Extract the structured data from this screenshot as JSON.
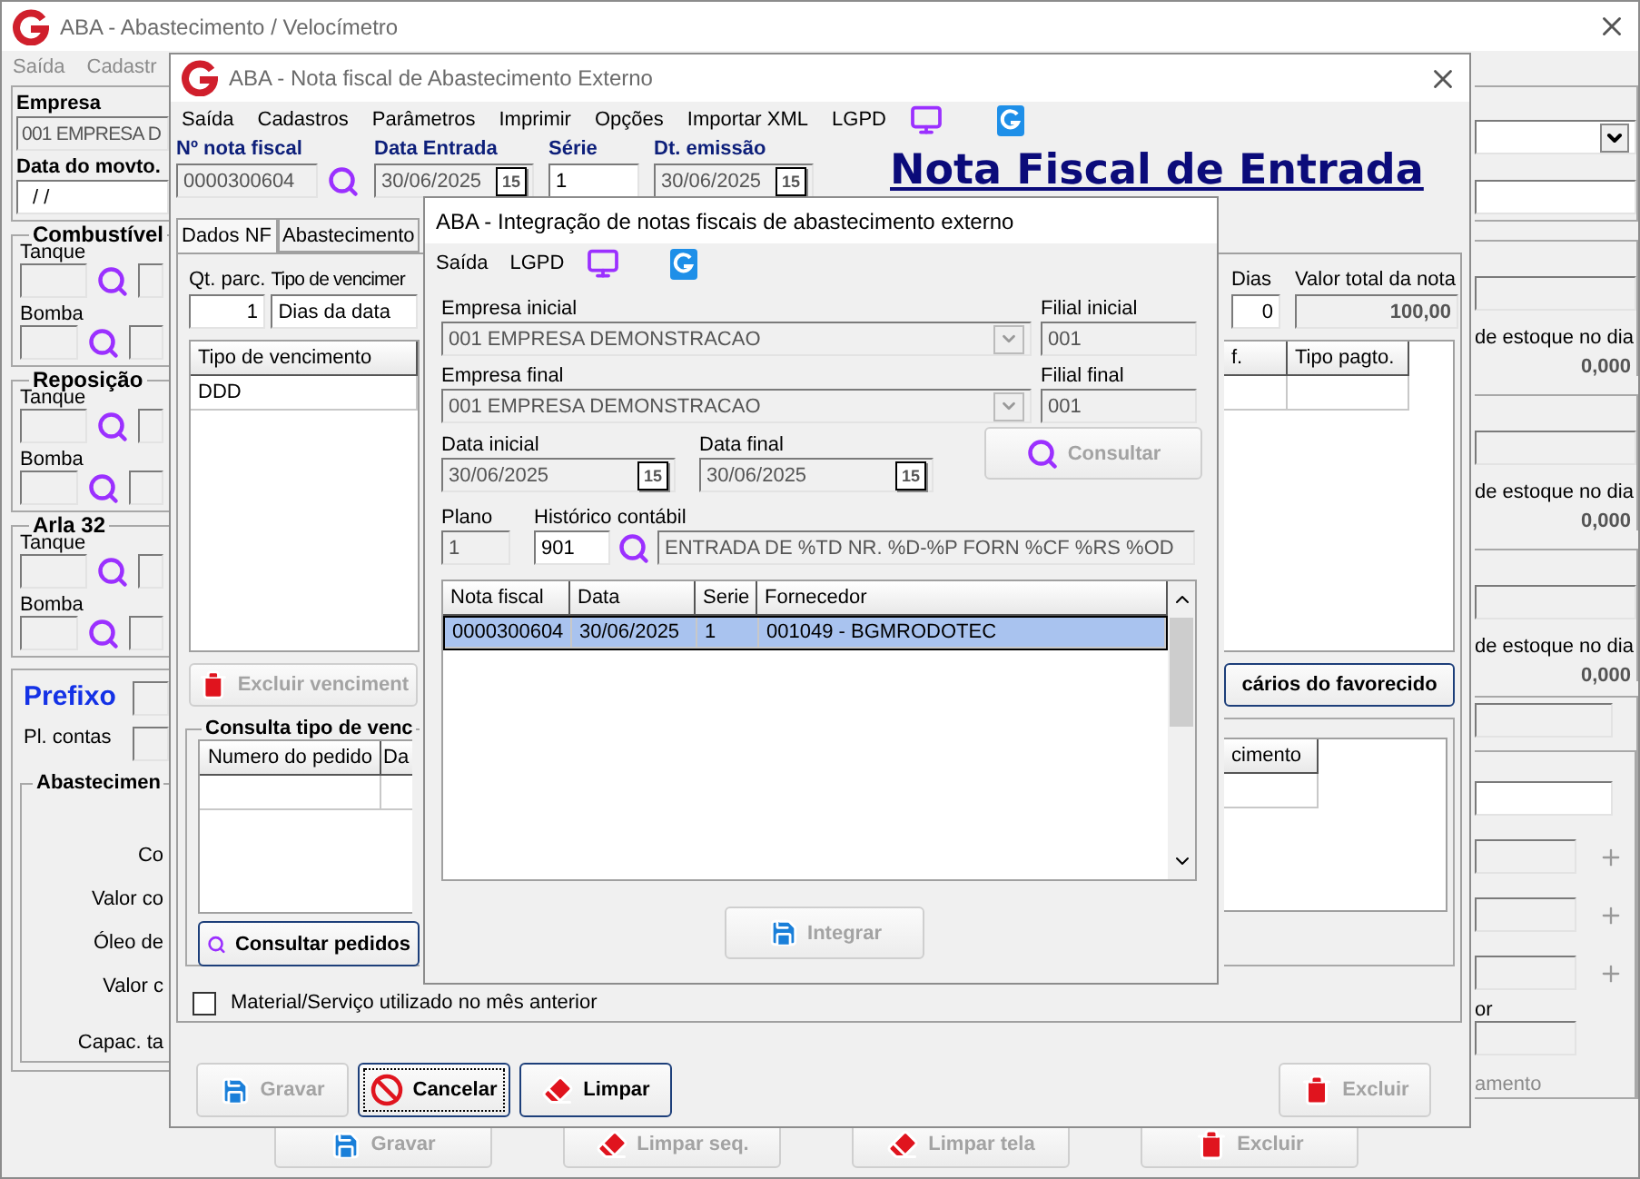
{
  "main_window": {
    "title": "ABA - Abastecimento / Velocímetro",
    "menu": [
      "Saída",
      "Cadastr"
    ],
    "left_panel": {
      "company_label": "Empresa",
      "company_value": "001 EMPRESA D",
      "date_label": "Data do movto.",
      "date_value": "/ /",
      "groups": [
        {
          "title": "Combustível",
          "rows": [
            "Tanque",
            "Bomba"
          ]
        },
        {
          "title": "Reposição",
          "rows": [
            "Tanque",
            "Bomba"
          ]
        },
        {
          "title": "Arla 32",
          "rows": [
            "Tanque",
            "Bomba"
          ]
        }
      ],
      "prefix_label": "Prefixo",
      "accounts_label": "Pl. contas",
      "fueling_title": "Abastecimen",
      "fueling_labels": [
        "Co",
        "Valor co",
        "Óleo de",
        "Valor c",
        "Capac. ta"
      ]
    },
    "right_panel": {
      "stock": [
        {
          "label": "de estoque no dia",
          "value": "0,000"
        },
        {
          "label": "de estoque no dia",
          "value": "0,000"
        },
        {
          "label": "de estoque no dia",
          "value": "0,000"
        }
      ],
      "label_1": "or",
      "label_2": "amento"
    },
    "buttons": [
      {
        "label": "Gravar",
        "kind": "save",
        "disabled": true
      },
      {
        "label": "Limpar seq.",
        "kind": "eraser",
        "disabled": true
      },
      {
        "label": "Limpar tela",
        "kind": "eraser",
        "disabled": true
      },
      {
        "label": "Excluir",
        "kind": "trash",
        "disabled": true
      }
    ]
  },
  "invoice_window": {
    "title": "ABA - Nota fiscal de Abastecimento Externo",
    "menu": [
      "Saída",
      "Cadastros",
      "Parâmetros",
      "Imprimir",
      "Opções",
      "Importar XML",
      "LGPD"
    ],
    "fields": [
      {
        "kind": "search",
        "label": "Nº nota fiscal",
        "value": "0000300604"
      },
      {
        "kind": "date",
        "label": "Data Entrada",
        "value": "30/06/2025",
        "button": "15"
      },
      {
        "kind": "text",
        "label": "Série",
        "value": "1"
      },
      {
        "kind": "date",
        "label": "Dt. emissão",
        "value": "30/06/2025",
        "button": "15"
      }
    ],
    "heading": "Nota Fiscal de Entrada",
    "tabs": [
      {
        "label": "Dados NF",
        "selected": true
      },
      {
        "label": "Abastecimento",
        "selected": false
      }
    ],
    "installments_label": "Qt. parc.",
    "installments_value": "1",
    "due_type_label": "Tipo de vencimer",
    "due_type_value": "Dias da data",
    "days_label": "Dias",
    "days_value": "0",
    "total_label": "Valor total da nota",
    "total_value": "100,00",
    "due_table": {
      "columns": [
        "Tipo de vencimento"
      ],
      "rows": [
        [
          "DDD"
        ]
      ]
    },
    "payment_table": {
      "columns": [
        "f.",
        "Tipo pagto."
      ]
    },
    "delete_due_button": {
      "label": "Excluir venciment",
      "kind": "trash",
      "disabled": true
    },
    "bank_button": {
      "label": "cários do favorecido",
      "disabled": false
    },
    "orders_group": {
      "title": "Consulta tipo de venc",
      "columns": [
        "Numero do pedido",
        "Da"
      ],
      "right_column": "cimento"
    },
    "orders_button": {
      "label": "Consultar pedidos",
      "kind": "search",
      "disabled": false
    },
    "previous_month": {
      "label": "Material/Serviço utilizado no mês anterior",
      "checked": false
    },
    "buttons": [
      {
        "label": "Gravar",
        "kind": "save",
        "disabled": true,
        "focused": false
      },
      {
        "label": "Cancelar",
        "kind": "ban",
        "disabled": false,
        "focused": true
      },
      {
        "label": "Limpar",
        "kind": "eraser",
        "disabled": false,
        "focused": false
      },
      {
        "label": "Excluir",
        "kind": "trash",
        "disabled": true,
        "focused": false
      }
    ]
  },
  "integration_window": {
    "title": "ABA - Integração de notas fiscais de abastecimento externo",
    "menu": [
      "Saída",
      "LGPD"
    ],
    "company_start": {
      "label": "Empresa inicial",
      "value": "001 EMPRESA DEMONSTRACAO"
    },
    "branch_start": {
      "label": "Filial inicial",
      "value": "001"
    },
    "company_end": {
      "label": "Empresa final",
      "value": "001 EMPRESA DEMONSTRACAO"
    },
    "branch_end": {
      "label": "Filial final",
      "value": "001"
    },
    "date_start": {
      "label": "Data inicial",
      "value": "30/06/2025",
      "button": "15"
    },
    "date_end": {
      "label": "Data final",
      "value": "30/06/2025",
      "button": "15"
    },
    "query_button": {
      "label": "Consultar",
      "kind": "search",
      "disabled": true
    },
    "plan": {
      "label": "Plano",
      "value": "1"
    },
    "history": {
      "label": "Histórico contábil",
      "code": "901",
      "description": "ENTRADA DE %TD NR. %D-%P FORN %CF %RS %OD"
    },
    "table": {
      "columns": [
        "Nota fiscal",
        "Data",
        "Serie",
        "Fornecedor"
      ],
      "rows": [
        {
          "cells": [
            "0000300604",
            "30/06/2025",
            "1",
            "001049 - BGMRODOTEC"
          ],
          "selected": true
        }
      ]
    },
    "integrate_button": {
      "label": "Integrar",
      "kind": "save",
      "disabled": true
    }
  }
}
